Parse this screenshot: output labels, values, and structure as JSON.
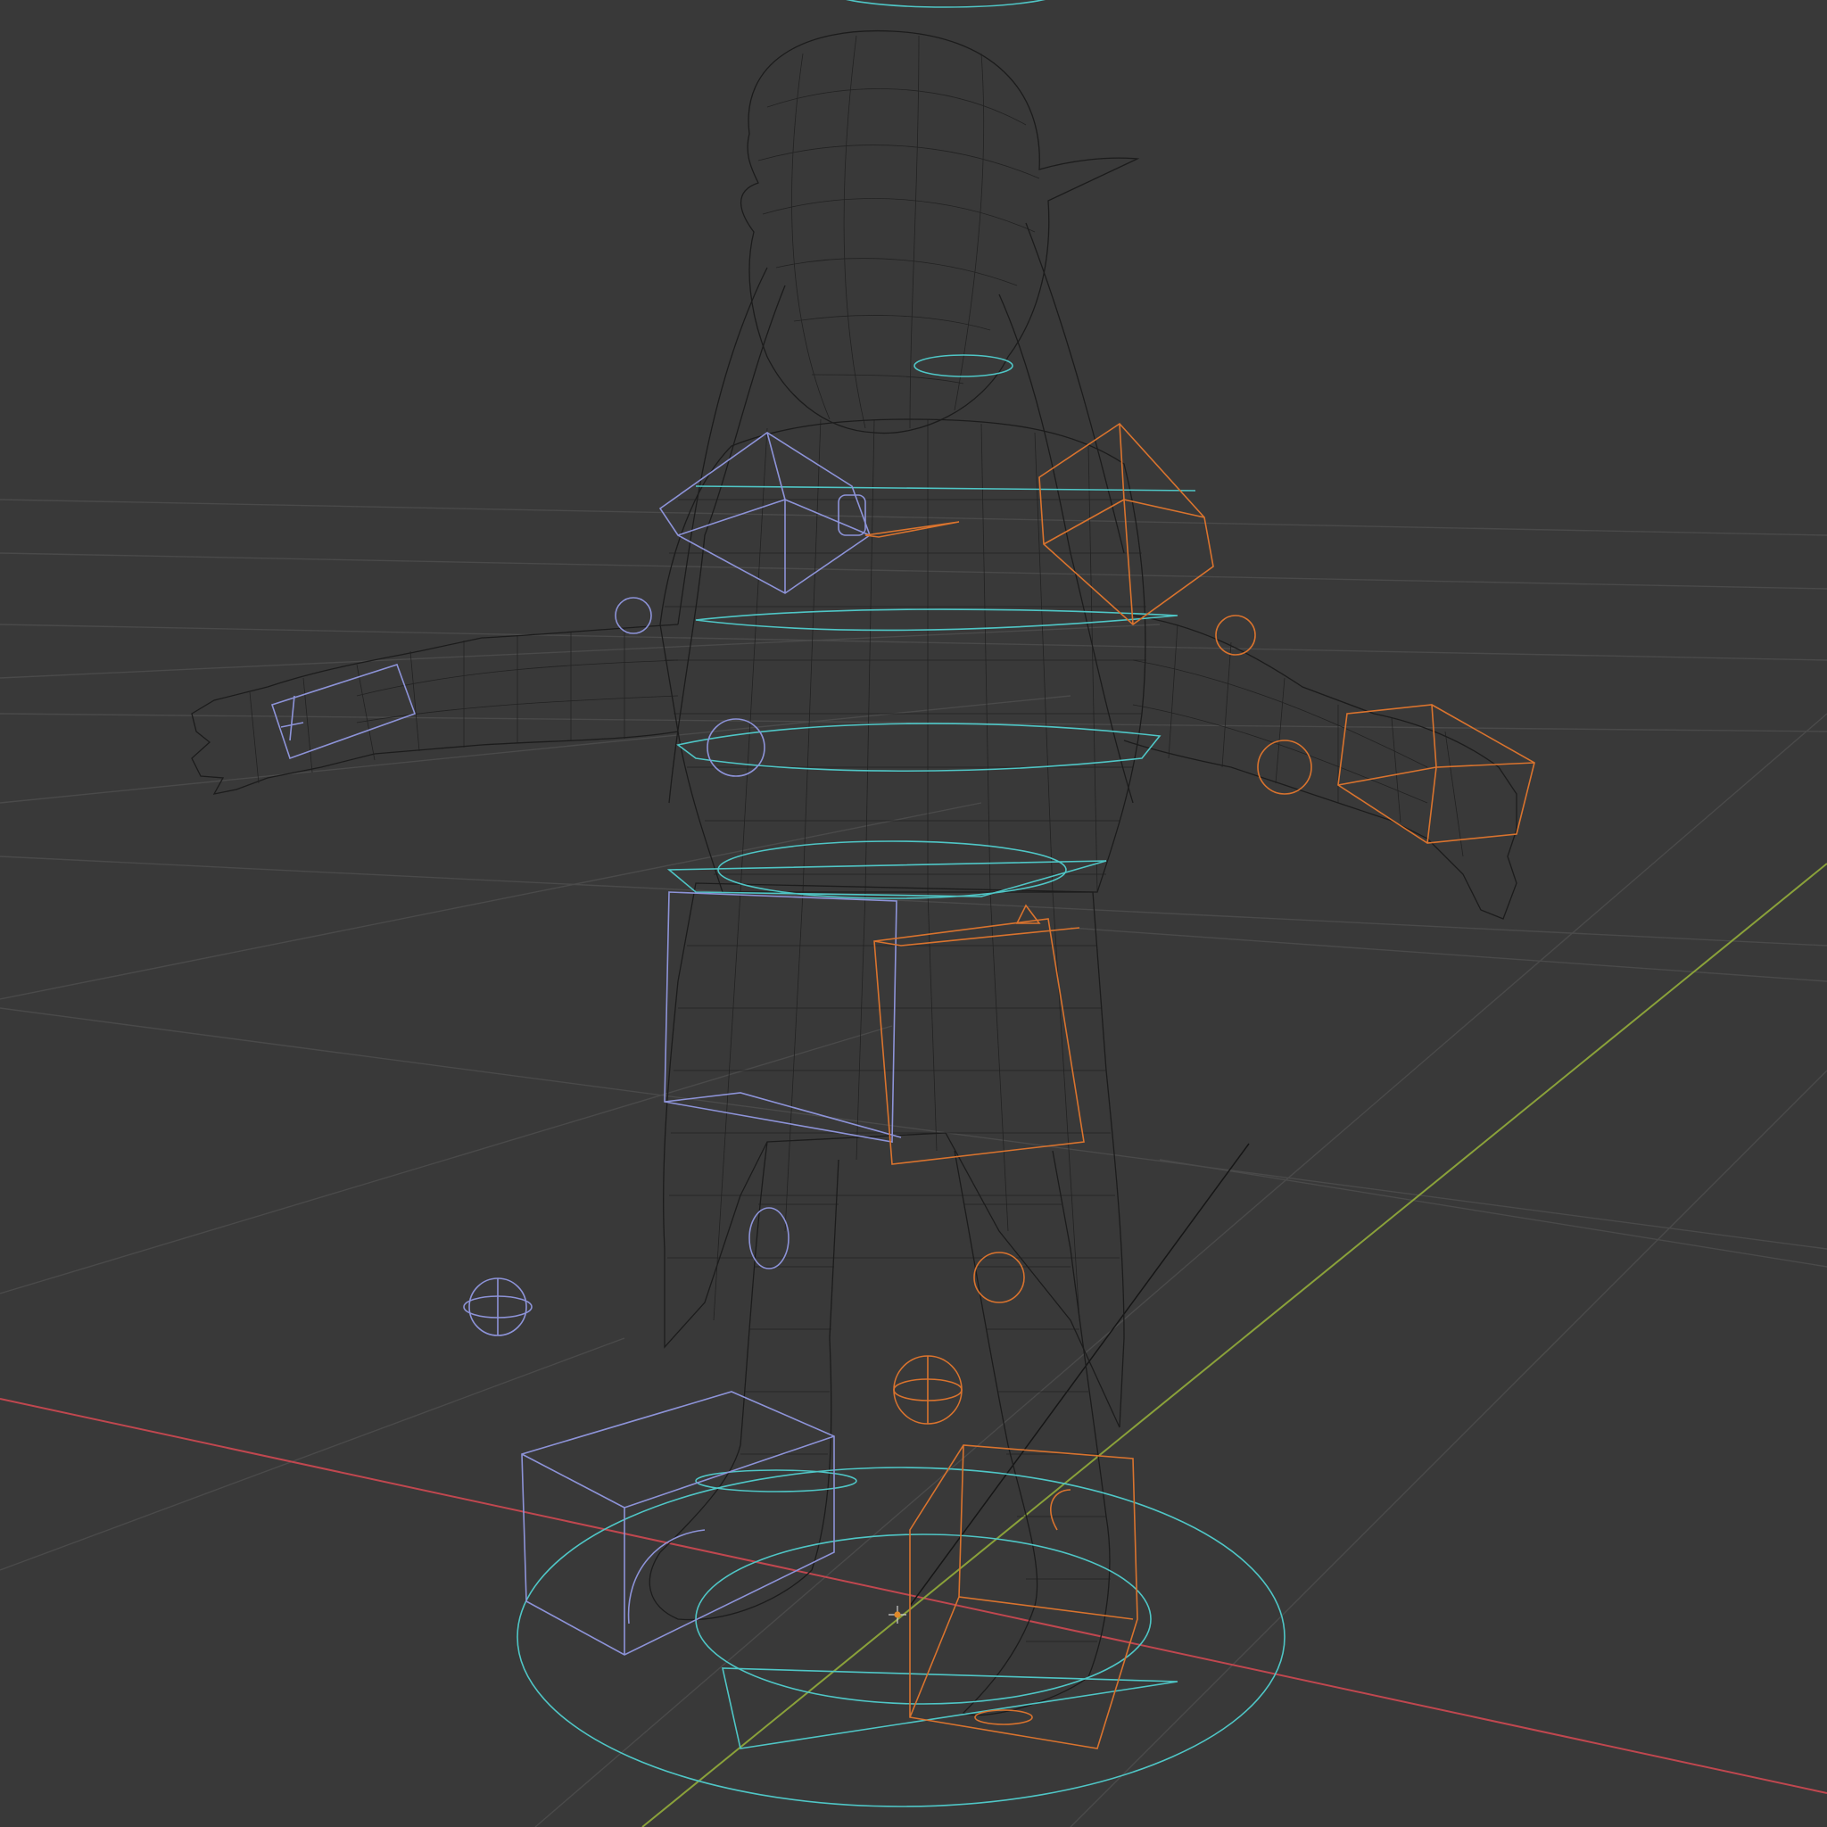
{
  "viewport": {
    "background": "#393939",
    "grid_color": "#4a4a4a",
    "x_axis_color": "#c0474f",
    "y_axis_color": "#8aa13a",
    "mesh_color": "#1c1c1c"
  },
  "controls": {
    "center_color": "#4fc6c6",
    "left_color": "#8d93d8",
    "right_color": "#d9732e"
  },
  "icons": {
    "origin": "3d-cursor-icon"
  }
}
